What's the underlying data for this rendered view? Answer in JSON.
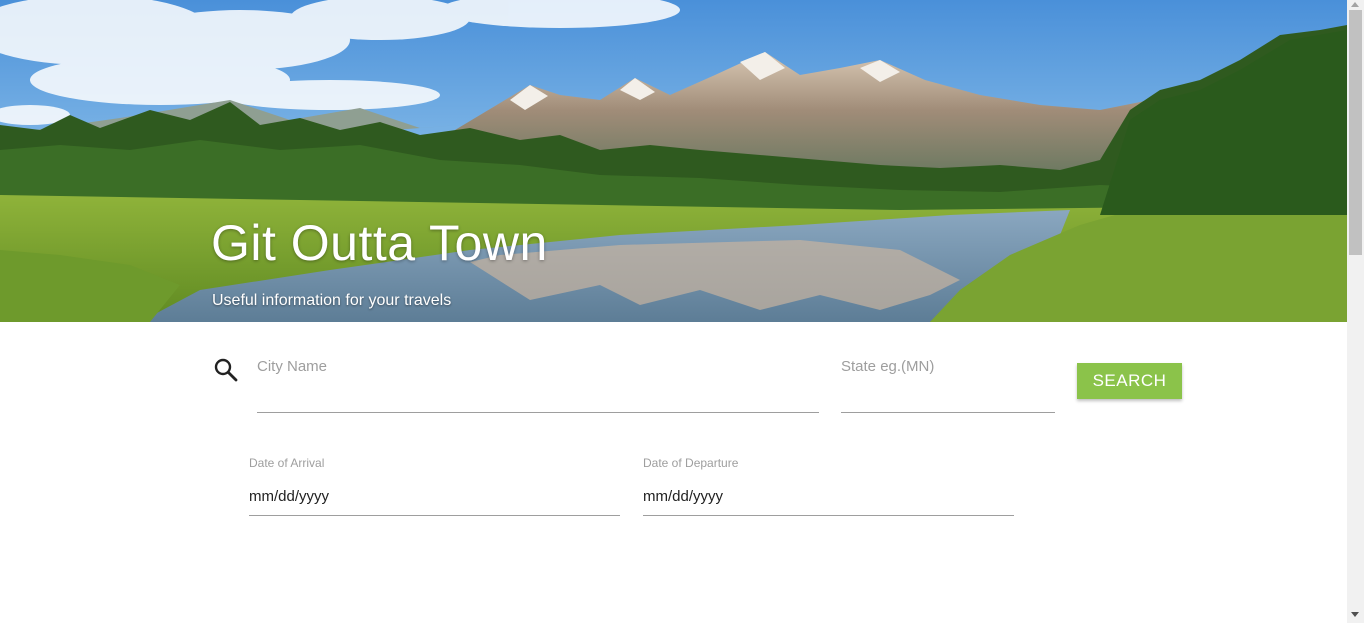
{
  "hero": {
    "title": "Git Outta Town",
    "subtitle": "Useful information for your travels"
  },
  "search": {
    "city_placeholder": "City Name",
    "city_value": "",
    "state_placeholder": "State eg.(MN)",
    "state_value": "",
    "button_label": "SEARCH",
    "icon": "search-icon"
  },
  "dates": {
    "arrival_label": "Date of Arrival",
    "arrival_value": "mm/dd/yyyy",
    "departure_label": "Date of Departure",
    "departure_value": "mm/dd/yyyy"
  },
  "colors": {
    "accent": "#8bc34a",
    "underline": "#9e9e9e",
    "placeholder": "#9e9e9e"
  }
}
